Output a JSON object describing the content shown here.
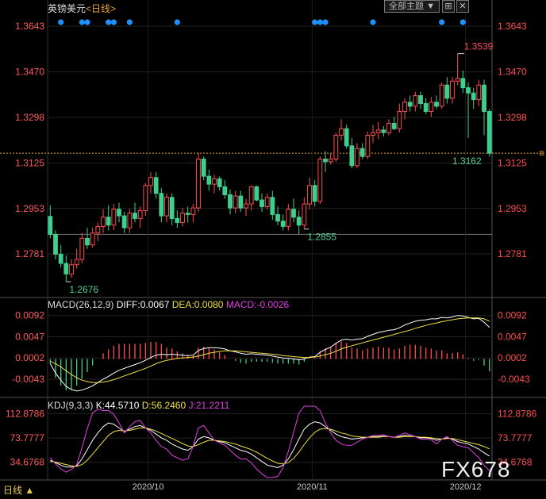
{
  "header": {
    "symbol": "英镑美元",
    "period": "<日线>",
    "main_indicator_button": "全部主题",
    "gear_button": "⊞",
    "close_button": "✕"
  },
  "bottom_bar": {
    "period_label": "日线 ▲"
  },
  "watermark": "FX678",
  "colors": {
    "up": "#ff4d4d",
    "down": "#3ecf8e",
    "label_red": "#ff4d6a",
    "label_green": "#4fd29a",
    "axis_text_left": "#ff5a5a",
    "axis_text_right": "#ff4d4d",
    "grid": "#3a3a3a",
    "dot": "#1e90ff",
    "macd_dif": "#ffffff",
    "macd_dea": "#f0e040",
    "kdj_k": "#ffffff",
    "kdj_d": "#f0e040",
    "kdj_j": "#e040e0"
  },
  "chart_data": [
    {
      "type": "candlestick",
      "name": "main",
      "y_ticks": [
        "1.3643",
        "1.3470",
        "1.3298",
        "1.3125",
        "1.2953",
        "1.2781"
      ],
      "ylim": [
        1.2625,
        1.37
      ],
      "x_ticks": [
        "2020/10",
        "2020/11",
        "2020/12"
      ],
      "last_price": "1.3162",
      "annotations": [
        {
          "text": "1.3539",
          "kind": "high",
          "bar": 77
        },
        {
          "text": "1.2855",
          "kind": "low",
          "bar": 48
        },
        {
          "text": "1.2676",
          "kind": "low",
          "bar": 3
        },
        {
          "text": "1.3162",
          "kind": "last",
          "bar": 83
        }
      ],
      "signal_dots_bars": [
        2,
        6,
        7,
        11,
        12,
        15,
        24,
        50,
        51,
        52,
        61,
        74,
        78
      ],
      "candles": [
        [
          1.2923,
          1.2965,
          1.284,
          1.2855
        ],
        [
          1.2855,
          1.287,
          1.276,
          1.278
        ],
        [
          1.278,
          1.2815,
          1.273,
          1.2745
        ],
        [
          1.2745,
          1.2775,
          1.2676,
          1.2705
        ],
        [
          1.2705,
          1.276,
          1.269,
          1.274
        ],
        [
          1.274,
          1.28,
          1.2725,
          1.276
        ],
        [
          1.276,
          1.286,
          1.2745,
          1.284
        ],
        [
          1.284,
          1.288,
          1.28,
          1.2815
        ],
        [
          1.2815,
          1.288,
          1.2805,
          1.286
        ],
        [
          1.286,
          1.29,
          1.283,
          1.2885
        ],
        [
          1.2885,
          1.295,
          1.286,
          1.292
        ],
        [
          1.292,
          1.2965,
          1.287,
          1.289
        ],
        [
          1.289,
          1.297,
          1.287,
          1.295
        ],
        [
          1.295,
          1.2975,
          1.29,
          1.2925
        ],
        [
          1.2925,
          1.294,
          1.286,
          1.288
        ],
        [
          1.288,
          1.295,
          1.286,
          1.2935
        ],
        [
          1.2935,
          1.2975,
          1.29,
          1.2915
        ],
        [
          1.2915,
          1.296,
          1.288,
          1.2945
        ],
        [
          1.2945,
          1.305,
          1.2925,
          1.304
        ],
        [
          1.304,
          1.309,
          1.301,
          1.307
        ],
        [
          1.307,
          1.309,
          1.299,
          1.301
        ],
        [
          1.301,
          1.303,
          1.29,
          1.2925
        ],
        [
          1.2925,
          1.301,
          1.29,
          1.2995
        ],
        [
          1.2995,
          1.301,
          1.289,
          1.2915
        ],
        [
          1.2915,
          1.2945,
          1.288,
          1.29
        ],
        [
          1.29,
          1.2955,
          1.2885,
          1.2935
        ],
        [
          1.2935,
          1.296,
          1.29,
          1.293
        ],
        [
          1.293,
          1.297,
          1.29,
          1.2955
        ],
        [
          1.2955,
          1.3165,
          1.294,
          1.314
        ],
        [
          1.314,
          1.315,
          1.306,
          1.3075
        ],
        [
          1.3075,
          1.31,
          1.302,
          1.3045
        ],
        [
          1.3045,
          1.308,
          1.301,
          1.3065
        ],
        [
          1.3065,
          1.3075,
          1.302,
          1.3035
        ],
        [
          1.3035,
          1.306,
          1.299,
          1.3005
        ],
        [
          1.3005,
          1.3025,
          1.293,
          1.2955
        ],
        [
          1.2955,
          1.302,
          1.2935,
          1.3
        ],
        [
          1.3,
          1.302,
          1.294,
          1.2955
        ],
        [
          1.2955,
          1.299,
          1.2925,
          1.297
        ],
        [
          1.297,
          1.304,
          1.2945,
          1.3035
        ],
        [
          1.3035,
          1.304,
          1.298,
          1.2985
        ],
        [
          1.2985,
          1.301,
          1.294,
          1.296
        ],
        [
          1.296,
          1.301,
          1.295,
          1.2995
        ],
        [
          1.2995,
          1.302,
          1.291,
          1.293
        ],
        [
          1.293,
          1.296,
          1.289,
          1.2905
        ],
        [
          1.2905,
          1.293,
          1.287,
          1.2885
        ],
        [
          1.2885,
          1.297,
          1.287,
          1.295
        ],
        [
          1.295,
          1.299,
          1.29,
          1.292
        ],
        [
          1.292,
          1.2945,
          1.2855,
          1.289
        ],
        [
          1.289,
          1.2995,
          1.2875,
          1.297
        ],
        [
          1.297,
          1.307,
          1.295,
          1.304
        ],
        [
          1.304,
          1.306,
          1.296,
          1.298
        ],
        [
          1.298,
          1.315,
          1.297,
          1.314
        ],
        [
          1.314,
          1.317,
          1.309,
          1.313
        ],
        [
          1.313,
          1.316,
          1.312,
          1.314
        ],
        [
          1.314,
          1.324,
          1.313,
          1.323
        ],
        [
          1.323,
          1.329,
          1.321,
          1.3255
        ],
        [
          1.3255,
          1.327,
          1.318,
          1.319
        ],
        [
          1.319,
          1.322,
          1.3105,
          1.3115
        ],
        [
          1.3115,
          1.32,
          1.3105,
          1.318
        ],
        [
          1.318,
          1.32,
          1.314,
          1.315
        ],
        [
          1.315,
          1.3245,
          1.314,
          1.323
        ],
        [
          1.323,
          1.327,
          1.32,
          1.324
        ],
        [
          1.324,
          1.328,
          1.3215,
          1.325
        ],
        [
          1.325,
          1.3265,
          1.3225,
          1.324
        ],
        [
          1.324,
          1.329,
          1.323,
          1.3275
        ],
        [
          1.3275,
          1.33,
          1.325,
          1.3255
        ],
        [
          1.3255,
          1.335,
          1.324,
          1.332
        ],
        [
          1.332,
          1.337,
          1.329,
          1.3355
        ],
        [
          1.3355,
          1.338,
          1.332,
          1.334
        ],
        [
          1.334,
          1.3395,
          1.332,
          1.338
        ],
        [
          1.338,
          1.3395,
          1.333,
          1.335
        ],
        [
          1.335,
          1.337,
          1.331,
          1.332
        ],
        [
          1.332,
          1.3375,
          1.33,
          1.3355
        ],
        [
          1.3355,
          1.338,
          1.333,
          1.334
        ],
        [
          1.334,
          1.343,
          1.333,
          1.342
        ],
        [
          1.342,
          1.345,
          1.335,
          1.337
        ],
        [
          1.337,
          1.345,
          1.335,
          1.3435
        ],
        [
          1.3435,
          1.3539,
          1.342,
          1.3445
        ],
        [
          1.3445,
          1.3475,
          1.339,
          1.341
        ],
        [
          1.341,
          1.343,
          1.322,
          1.339
        ],
        [
          1.339,
          1.341,
          1.333,
          1.3365
        ],
        [
          1.3365,
          1.344,
          1.334,
          1.342
        ],
        [
          1.342,
          1.344,
          1.323,
          1.332
        ],
        [
          1.332,
          1.333,
          1.315,
          1.3162
        ]
      ]
    },
    {
      "type": "bar+line",
      "name": "MACD",
      "label": "MACD(26,12,9)",
      "dif_label": "DIFF:0.0067",
      "dea_label": "DEA:0.0080",
      "macd_label": "MACD:-0.0026",
      "y_ticks": [
        "0.0092",
        "0.0047",
        "0.0002",
        "-0.0043"
      ],
      "ylim": [
        -0.008,
        0.0105
      ],
      "dif": [
        -0.001,
        -0.003,
        -0.0045,
        -0.0058,
        -0.0065,
        -0.0068,
        -0.0066,
        -0.0062,
        -0.0057,
        -0.005,
        -0.0043,
        -0.0037,
        -0.003,
        -0.0024,
        -0.002,
        -0.0016,
        -0.0012,
        -0.0008,
        -0.0003,
        0.0003,
        0.0008,
        0.001,
        0.0009,
        0.001,
        0.0009,
        0.0008,
        0.0007,
        0.0008,
        0.0018,
        0.0022,
        0.0024,
        0.0024,
        0.0023,
        0.0021,
        0.0017,
        0.0015,
        0.0012,
        0.001,
        0.0011,
        0.001,
        0.0009,
        0.0008,
        0.0006,
        0.0004,
        0.0002,
        0.0001,
        0.0,
        -0.0002,
        0.0,
        0.0004,
        0.0005,
        0.0014,
        0.002,
        0.0025,
        0.0033,
        0.004,
        0.0042,
        0.004,
        0.0042,
        0.0043,
        0.0048,
        0.0052,
        0.0056,
        0.0058,
        0.0061,
        0.0062,
        0.0066,
        0.0072,
        0.0076,
        0.008,
        0.0082,
        0.0083,
        0.0085,
        0.0085,
        0.0088,
        0.0087,
        0.0089,
        0.0092,
        0.0091,
        0.0088,
        0.0085,
        0.0086,
        0.0078,
        0.0067
      ],
      "dea": [
        -0.0005,
        -0.001,
        -0.0017,
        -0.0025,
        -0.0033,
        -0.004,
        -0.0045,
        -0.0048,
        -0.005,
        -0.005,
        -0.0049,
        -0.0047,
        -0.0044,
        -0.004,
        -0.0036,
        -0.0032,
        -0.0028,
        -0.0024,
        -0.002,
        -0.0015,
        -0.001,
        -0.0006,
        -0.0003,
        -0.0001,
        0.0001,
        0.0002,
        0.0003,
        0.0004,
        0.0006,
        0.0009,
        0.0012,
        0.0014,
        0.0016,
        0.0017,
        0.0017,
        0.0017,
        0.0016,
        0.0015,
        0.0014,
        0.0013,
        0.0012,
        0.0011,
        0.001,
        0.0009,
        0.0007,
        0.0006,
        0.0005,
        0.0004,
        0.0003,
        0.0003,
        0.0004,
        0.0006,
        0.0009,
        0.0012,
        0.0016,
        0.0021,
        0.0025,
        0.0028,
        0.0031,
        0.0034,
        0.0037,
        0.004,
        0.0043,
        0.0046,
        0.0049,
        0.0052,
        0.0055,
        0.0058,
        0.0061,
        0.0065,
        0.0068,
        0.0071,
        0.0074,
        0.0076,
        0.0079,
        0.0081,
        0.0083,
        0.0085,
        0.0086,
        0.0087,
        0.0087,
        0.0087,
        0.0085,
        0.008
      ]
    },
    {
      "type": "line",
      "name": "KDJ",
      "label": "KDJ(9,3,3)",
      "k_label": "K:44.5710",
      "d_label": "D:56.2460",
      "j_label": "J:21.2211",
      "y_ticks": [
        "112.8786",
        "73.7777",
        "34.6768"
      ],
      "ylim": [
        10,
        125
      ],
      "k": [
        38,
        34,
        30,
        27,
        27,
        29,
        40,
        55,
        70,
        82,
        92,
        98,
        96,
        90,
        84,
        88,
        92,
        94,
        90,
        86,
        80,
        74,
        70,
        64,
        60,
        56,
        54,
        60,
        72,
        76,
        74,
        70,
        68,
        66,
        62,
        58,
        54,
        52,
        48,
        42,
        36,
        30,
        28,
        26,
        30,
        40,
        55,
        72,
        88,
        96,
        100,
        98,
        92,
        86,
        80,
        76,
        74,
        72,
        73,
        74,
        75,
        76,
        76,
        77,
        76,
        75,
        76,
        78,
        77,
        76,
        74,
        74,
        73,
        70,
        72,
        74,
        72,
        68,
        66,
        64,
        60,
        56,
        50,
        44.571
      ],
      "d": [
        36,
        35,
        33,
        31,
        29,
        28,
        31,
        38,
        48,
        58,
        68,
        78,
        84,
        86,
        85,
        86,
        88,
        90,
        90,
        88,
        85,
        81,
        77,
        73,
        69,
        65,
        61,
        60,
        63,
        67,
        70,
        70,
        69,
        68,
        66,
        64,
        61,
        58,
        55,
        51,
        46,
        41,
        37,
        33,
        32,
        34,
        41,
        51,
        63,
        74,
        83,
        88,
        89,
        88,
        85,
        82,
        80,
        77,
        76,
        75,
        75,
        75,
        75,
        76,
        76,
        75,
        75,
        76,
        76,
        76,
        75,
        75,
        74,
        73,
        72,
        73,
        73,
        71,
        69,
        67,
        65,
        63,
        60,
        56.246
      ],
      "j": [
        42,
        32,
        24,
        19,
        23,
        31,
        58,
        89,
        114,
        120,
        118,
        118,
        112,
        98,
        82,
        92,
        100,
        102,
        90,
        82,
        70,
        60,
        56,
        46,
        42,
        38,
        40,
        60,
        90,
        94,
        82,
        70,
        66,
        62,
        54,
        46,
        40,
        40,
        34,
        24,
        16,
        8,
        10,
        12,
        26,
        52,
        83,
        114,
        125,
        125,
        125,
        118,
        98,
        82,
        70,
        64,
        62,
        62,
        67,
        72,
        75,
        78,
        78,
        79,
        76,
        75,
        78,
        82,
        79,
        76,
        72,
        72,
        71,
        64,
        72,
        76,
        70,
        62,
        60,
        58,
        50,
        42,
        30,
        21.2211
      ]
    }
  ]
}
